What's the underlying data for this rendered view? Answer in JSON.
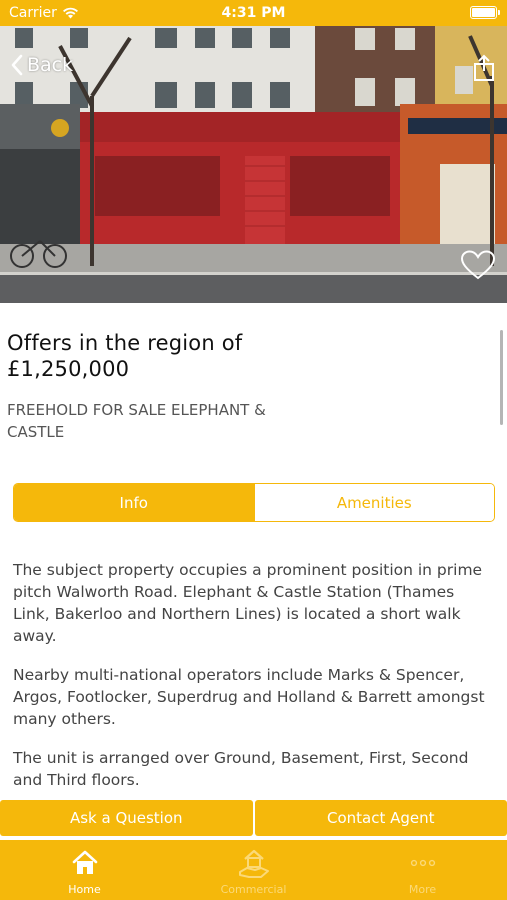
{
  "status_bar": {
    "carrier": "Carrier",
    "time": "4:31 PM"
  },
  "hero": {
    "back_label": "Back",
    "icons": {
      "back": "chevron-left-icon",
      "share": "share-icon",
      "favorite": "heart-icon"
    }
  },
  "listing": {
    "price": "Offers in the region of £1,250,000",
    "title": "FREEHOLD FOR SALE ELEPHANT & CASTLE"
  },
  "tabs_segment": {
    "selected": "Info",
    "options": [
      "Info",
      "Amenities"
    ]
  },
  "description": {
    "paragraphs": [
      "The subject property occupies a prominent position in prime pitch Walworth Road. Elephant & Castle Station (Thames Link, Bakerloo and Northern Lines) is located a short walk away.",
      "Nearby multi-national operators include Marks & Spencer, Argos, Footlocker, Superdrug and Holland & Barrett amongst many others.",
      "The unit is arranged over Ground, Basement, First, Second and Third floors."
    ]
  },
  "actions": {
    "ask_question": "Ask a Question",
    "contact_agent": "Contact Agent"
  },
  "tab_bar": {
    "items": [
      {
        "label": "Home",
        "icon": "home-icon",
        "selected": true
      },
      {
        "label": "Commercial",
        "icon": "commercial-hand-house-icon",
        "selected": false
      },
      {
        "label": "More",
        "icon": "more-dots-icon",
        "selected": false
      }
    ]
  },
  "colors": {
    "brand": "#f5b80b",
    "tab_inactive_text": "#fbd978",
    "body_text": "#444444"
  }
}
